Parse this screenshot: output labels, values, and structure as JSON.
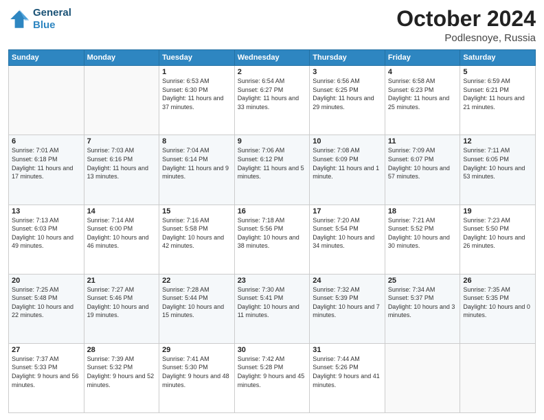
{
  "header": {
    "logo_line1": "General",
    "logo_line2": "Blue",
    "month_title": "October 2024",
    "location": "Podlesnoye, Russia"
  },
  "days_of_week": [
    "Sunday",
    "Monday",
    "Tuesday",
    "Wednesday",
    "Thursday",
    "Friday",
    "Saturday"
  ],
  "weeks": [
    [
      {
        "day": "",
        "sunrise": "",
        "sunset": "",
        "daylight": ""
      },
      {
        "day": "",
        "sunrise": "",
        "sunset": "",
        "daylight": ""
      },
      {
        "day": "1",
        "sunrise": "Sunrise: 6:53 AM",
        "sunset": "Sunset: 6:30 PM",
        "daylight": "Daylight: 11 hours and 37 minutes."
      },
      {
        "day": "2",
        "sunrise": "Sunrise: 6:54 AM",
        "sunset": "Sunset: 6:27 PM",
        "daylight": "Daylight: 11 hours and 33 minutes."
      },
      {
        "day": "3",
        "sunrise": "Sunrise: 6:56 AM",
        "sunset": "Sunset: 6:25 PM",
        "daylight": "Daylight: 11 hours and 29 minutes."
      },
      {
        "day": "4",
        "sunrise": "Sunrise: 6:58 AM",
        "sunset": "Sunset: 6:23 PM",
        "daylight": "Daylight: 11 hours and 25 minutes."
      },
      {
        "day": "5",
        "sunrise": "Sunrise: 6:59 AM",
        "sunset": "Sunset: 6:21 PM",
        "daylight": "Daylight: 11 hours and 21 minutes."
      }
    ],
    [
      {
        "day": "6",
        "sunrise": "Sunrise: 7:01 AM",
        "sunset": "Sunset: 6:18 PM",
        "daylight": "Daylight: 11 hours and 17 minutes."
      },
      {
        "day": "7",
        "sunrise": "Sunrise: 7:03 AM",
        "sunset": "Sunset: 6:16 PM",
        "daylight": "Daylight: 11 hours and 13 minutes."
      },
      {
        "day": "8",
        "sunrise": "Sunrise: 7:04 AM",
        "sunset": "Sunset: 6:14 PM",
        "daylight": "Daylight: 11 hours and 9 minutes."
      },
      {
        "day": "9",
        "sunrise": "Sunrise: 7:06 AM",
        "sunset": "Sunset: 6:12 PM",
        "daylight": "Daylight: 11 hours and 5 minutes."
      },
      {
        "day": "10",
        "sunrise": "Sunrise: 7:08 AM",
        "sunset": "Sunset: 6:09 PM",
        "daylight": "Daylight: 11 hours and 1 minute."
      },
      {
        "day": "11",
        "sunrise": "Sunrise: 7:09 AM",
        "sunset": "Sunset: 6:07 PM",
        "daylight": "Daylight: 10 hours and 57 minutes."
      },
      {
        "day": "12",
        "sunrise": "Sunrise: 7:11 AM",
        "sunset": "Sunset: 6:05 PM",
        "daylight": "Daylight: 10 hours and 53 minutes."
      }
    ],
    [
      {
        "day": "13",
        "sunrise": "Sunrise: 7:13 AM",
        "sunset": "Sunset: 6:03 PM",
        "daylight": "Daylight: 10 hours and 49 minutes."
      },
      {
        "day": "14",
        "sunrise": "Sunrise: 7:14 AM",
        "sunset": "Sunset: 6:00 PM",
        "daylight": "Daylight: 10 hours and 46 minutes."
      },
      {
        "day": "15",
        "sunrise": "Sunrise: 7:16 AM",
        "sunset": "Sunset: 5:58 PM",
        "daylight": "Daylight: 10 hours and 42 minutes."
      },
      {
        "day": "16",
        "sunrise": "Sunrise: 7:18 AM",
        "sunset": "Sunset: 5:56 PM",
        "daylight": "Daylight: 10 hours and 38 minutes."
      },
      {
        "day": "17",
        "sunrise": "Sunrise: 7:20 AM",
        "sunset": "Sunset: 5:54 PM",
        "daylight": "Daylight: 10 hours and 34 minutes."
      },
      {
        "day": "18",
        "sunrise": "Sunrise: 7:21 AM",
        "sunset": "Sunset: 5:52 PM",
        "daylight": "Daylight: 10 hours and 30 minutes."
      },
      {
        "day": "19",
        "sunrise": "Sunrise: 7:23 AM",
        "sunset": "Sunset: 5:50 PM",
        "daylight": "Daylight: 10 hours and 26 minutes."
      }
    ],
    [
      {
        "day": "20",
        "sunrise": "Sunrise: 7:25 AM",
        "sunset": "Sunset: 5:48 PM",
        "daylight": "Daylight: 10 hours and 22 minutes."
      },
      {
        "day": "21",
        "sunrise": "Sunrise: 7:27 AM",
        "sunset": "Sunset: 5:46 PM",
        "daylight": "Daylight: 10 hours and 19 minutes."
      },
      {
        "day": "22",
        "sunrise": "Sunrise: 7:28 AM",
        "sunset": "Sunset: 5:44 PM",
        "daylight": "Daylight: 10 hours and 15 minutes."
      },
      {
        "day": "23",
        "sunrise": "Sunrise: 7:30 AM",
        "sunset": "Sunset: 5:41 PM",
        "daylight": "Daylight: 10 hours and 11 minutes."
      },
      {
        "day": "24",
        "sunrise": "Sunrise: 7:32 AM",
        "sunset": "Sunset: 5:39 PM",
        "daylight": "Daylight: 10 hours and 7 minutes."
      },
      {
        "day": "25",
        "sunrise": "Sunrise: 7:34 AM",
        "sunset": "Sunset: 5:37 PM",
        "daylight": "Daylight: 10 hours and 3 minutes."
      },
      {
        "day": "26",
        "sunrise": "Sunrise: 7:35 AM",
        "sunset": "Sunset: 5:35 PM",
        "daylight": "Daylight: 10 hours and 0 minutes."
      }
    ],
    [
      {
        "day": "27",
        "sunrise": "Sunrise: 7:37 AM",
        "sunset": "Sunset: 5:33 PM",
        "daylight": "Daylight: 9 hours and 56 minutes."
      },
      {
        "day": "28",
        "sunrise": "Sunrise: 7:39 AM",
        "sunset": "Sunset: 5:32 PM",
        "daylight": "Daylight: 9 hours and 52 minutes."
      },
      {
        "day": "29",
        "sunrise": "Sunrise: 7:41 AM",
        "sunset": "Sunset: 5:30 PM",
        "daylight": "Daylight: 9 hours and 48 minutes."
      },
      {
        "day": "30",
        "sunrise": "Sunrise: 7:42 AM",
        "sunset": "Sunset: 5:28 PM",
        "daylight": "Daylight: 9 hours and 45 minutes."
      },
      {
        "day": "31",
        "sunrise": "Sunrise: 7:44 AM",
        "sunset": "Sunset: 5:26 PM",
        "daylight": "Daylight: 9 hours and 41 minutes."
      },
      {
        "day": "",
        "sunrise": "",
        "sunset": "",
        "daylight": ""
      },
      {
        "day": "",
        "sunrise": "",
        "sunset": "",
        "daylight": ""
      }
    ]
  ]
}
